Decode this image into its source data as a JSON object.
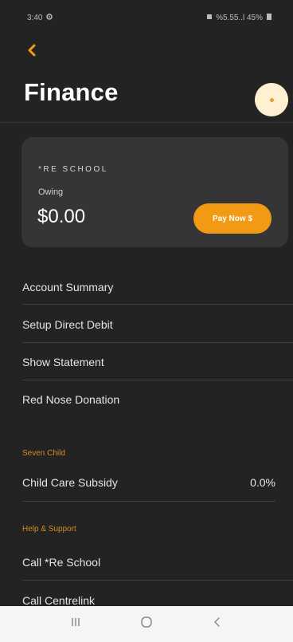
{
  "status_bar": {
    "time": "3:40",
    "right_text": "%5.55..l 45%"
  },
  "header": {
    "title": "Finance"
  },
  "finance_card": {
    "school_name": "*RE SCHOOL",
    "owing_label": "Owing",
    "owing_amount": "$0.00",
    "pay_button_label": "Pay Now $"
  },
  "menu": {
    "items": [
      {
        "label": "Account Summary"
      },
      {
        "label": "Setup Direct Debit"
      },
      {
        "label": "Show Statement"
      },
      {
        "label": "Red Nose Donation"
      }
    ]
  },
  "child_section": {
    "header": "Seven Child",
    "items": [
      {
        "label": "Child Care Subsidy",
        "value": "0.0%"
      }
    ]
  },
  "help_section": {
    "header": "Help & Support",
    "items": [
      {
        "label": "Call *Re School"
      },
      {
        "label": "Call Centrelink"
      }
    ]
  },
  "icons": {
    "back": "chevron-left-icon",
    "nav_recents": "recents-icon",
    "nav_home": "home-icon",
    "nav_back": "back-icon"
  },
  "colors": {
    "background": "#232323",
    "card": "#353538",
    "accent": "#f39a14",
    "section_header": "#d48a26",
    "nav_bar": "#f5f5f5"
  }
}
